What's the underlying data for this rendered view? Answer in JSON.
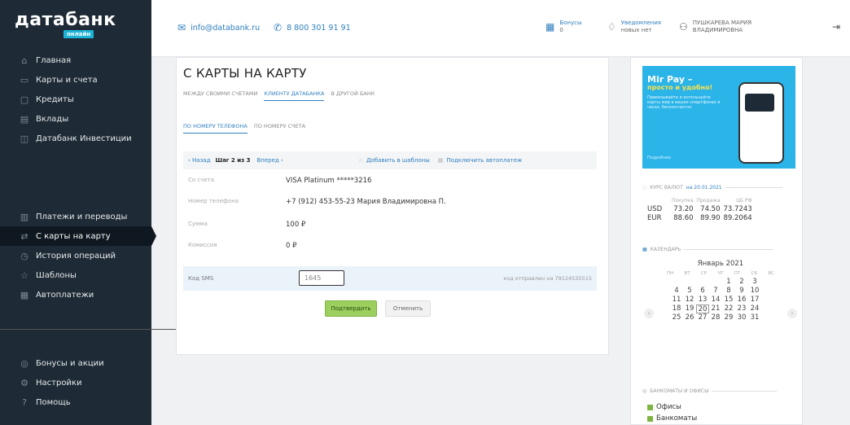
{
  "logo": {
    "main": "датабанк",
    "sub": "онлайн"
  },
  "sidebar": {
    "top": [
      {
        "label": "Главная",
        "icon": "home-icon",
        "glyph": "⌂"
      },
      {
        "label": "Карты и счета",
        "icon": "card-icon",
        "glyph": "▭"
      },
      {
        "label": "Кредиты",
        "icon": "bag-icon",
        "glyph": "▢"
      },
      {
        "label": "Вклады",
        "icon": "deposit-icon",
        "glyph": "▤"
      },
      {
        "label": "Датабанк Инвестиции",
        "icon": "chart-icon",
        "glyph": "◫"
      }
    ],
    "mid": [
      {
        "label": "Платежи и переводы",
        "icon": "payment-icon",
        "glyph": "▥"
      },
      {
        "label": "С карты на карту",
        "icon": "card-transfer-icon",
        "glyph": "⇄",
        "active": true
      },
      {
        "label": "История операций",
        "icon": "history-icon",
        "glyph": "◷"
      },
      {
        "label": "Шаблоны",
        "icon": "star-icon",
        "glyph": "☆"
      },
      {
        "label": "Автоплатежи",
        "icon": "autopay-icon",
        "glyph": "▦"
      }
    ],
    "bottom": [
      {
        "label": "Бонусы и акции",
        "icon": "gift-icon",
        "glyph": "◎"
      },
      {
        "label": "Настройки",
        "icon": "gear-icon",
        "glyph": "⚙"
      },
      {
        "label": "Помощь",
        "icon": "help-icon",
        "glyph": "?"
      }
    ]
  },
  "topbar": {
    "email": "info@databank.ru",
    "phone": "8 800 301 91 91",
    "bonus_label": "Бонусы",
    "bonus_value": "0",
    "notify_label": "Уведомления",
    "notify_value": "новых нет",
    "user_line1": "ПУШКАРЕВА МАРИЯ",
    "user_line2": "ВЛАДИМИРОВНА"
  },
  "main": {
    "title": "С КАРТЫ НА КАРТУ",
    "tabs1": [
      "МЕЖДУ СВОИМИ СЧЕТАМИ",
      "КЛИЕНТУ ДАТАБАНКА",
      "В ДРУГОЙ БАНК"
    ],
    "tabs2": [
      "ПО НОМЕРУ ТЕЛЕФОНА",
      "ПО НОМЕРУ СЧЕТА"
    ],
    "step": {
      "back": "‹ Назад",
      "current": "Шаг 2 из 3",
      "forward": "Вперед ›",
      "template": "Добавить в шаблоны",
      "autopay": "Подключить автоплатеж"
    },
    "rows": [
      {
        "label": "Со счета",
        "value": "VISA Platinum *****3216"
      },
      {
        "label": "Номер телефона",
        "value": "+7 (912) 453-55-23   Мария Владимировна П."
      },
      {
        "label": "Сумма",
        "value": "100 ₽"
      },
      {
        "label": "Комиссия",
        "value": "0 ₽"
      }
    ],
    "sms": {
      "label": "Код SMS",
      "value": "1645",
      "hint": "код отправлен на 79124535515"
    },
    "confirm": "Подтвердить",
    "cancel": "Отменить"
  },
  "right": {
    "banner": {
      "t1": "Mir Pay –",
      "t2": "просто и удобно!",
      "t3": "Привязывайте и используйте карты мир в ваших смартфонах и часах, бесконтактно",
      "more": "Подробнее"
    },
    "rates_title": "КУРС ВАЛЮТ",
    "rates_date": "на 20.01.2021",
    "rates_head": [
      "Покупка",
      "Продажа",
      "ЦБ РФ"
    ],
    "rates": [
      [
        "USD",
        "73.20",
        "74.50",
        "73.7243"
      ],
      [
        "EUR",
        "88.60",
        "89.90",
        "89.2064"
      ]
    ],
    "cal_title": "КАЛЕНДАРЬ",
    "cal_month": "Январь 2021",
    "cal_weekdays": [
      "ПН",
      "ВТ",
      "СР",
      "ЧТ",
      "ПТ",
      "СБ",
      "ВС"
    ],
    "cal_weeks": [
      [
        "",
        "",
        "",
        "",
        "1",
        "2",
        "3"
      ],
      [
        "4",
        "5",
        "6",
        "7",
        "8",
        "9",
        "10"
      ],
      [
        "11",
        "12",
        "13",
        "14",
        "15",
        "16",
        "17"
      ],
      [
        "18",
        "19",
        "20",
        "21",
        "22",
        "23",
        "24"
      ],
      [
        "25",
        "26",
        "27",
        "28",
        "29",
        "30",
        "31"
      ]
    ],
    "cal_selected": "20",
    "atm_title": "БАНКОМАТЫ И ОФИСЫ",
    "atm_items": [
      "Офисы",
      "Банкоматы"
    ]
  }
}
